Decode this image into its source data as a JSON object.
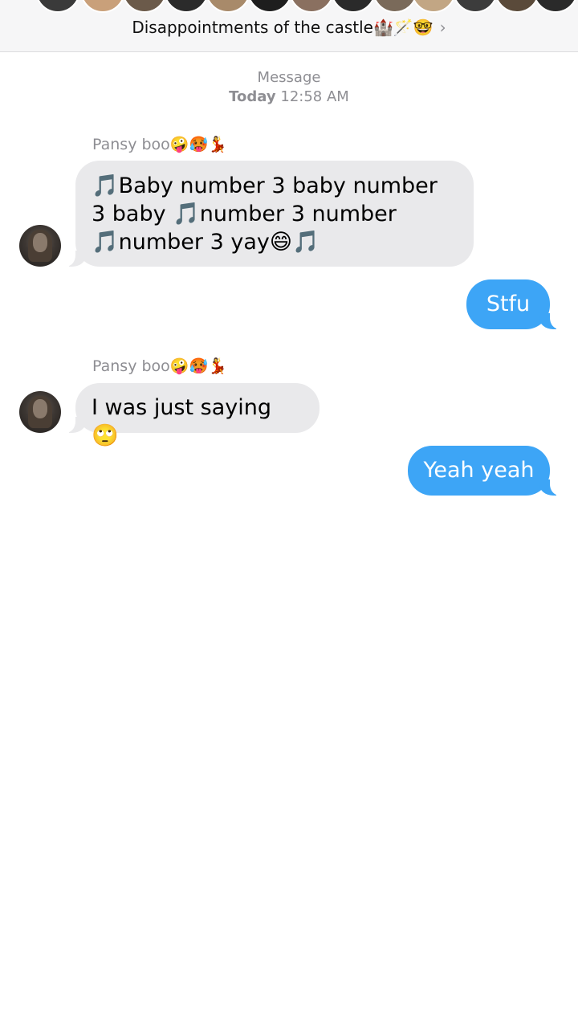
{
  "header": {
    "group_title": "Disappointments of the castle🏰🪄🤓",
    "chevron_glyph": "›",
    "participant_avatar_colors": [
      "#3a3a3a",
      "#c9a07a",
      "#6b5a4a",
      "#2b2b2b",
      "#a88a6a",
      "#1e1e1e",
      "#8a7060",
      "#2a2a2a",
      "#7a6a5a",
      "#c2a684",
      "#3c3c3c",
      "#5a4a3a",
      "#2a2a2a",
      "#8c8c8c"
    ]
  },
  "conversation": {
    "timestamp_label": "Message",
    "timestamp_day": "Today",
    "timestamp_time": "12:58 AM"
  },
  "messages": [
    {
      "sender": "Pansy boo🤪🥵💃",
      "direction": "incoming",
      "text": "🎵Baby number 3 baby number 3 baby 🎵number 3 number 🎵number 3 yay😄🎵"
    },
    {
      "direction": "outgoing",
      "text": "Stfu"
    },
    {
      "sender": "Pansy boo🤪🥵💃",
      "direction": "incoming",
      "text": "I was just saying 🙄"
    },
    {
      "direction": "outgoing",
      "text": "Yeah yeah"
    }
  ],
  "colors": {
    "incoming_bubble": "#e9e9eb",
    "outgoing_bubble": "#3da5f6",
    "secondary_text": "#8e8e93"
  }
}
